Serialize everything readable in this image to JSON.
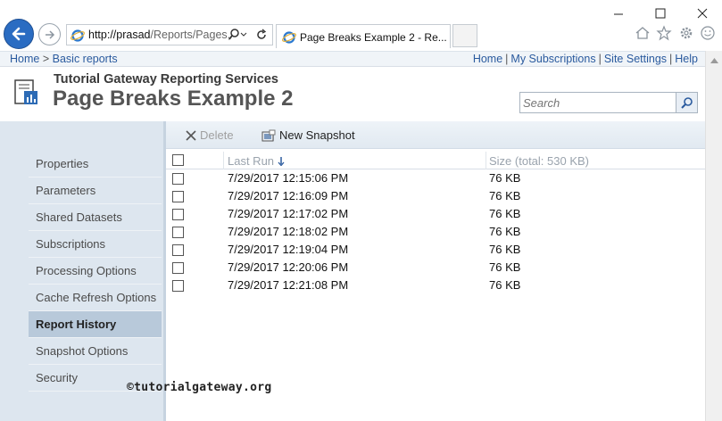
{
  "browser": {
    "url_host": "http://prasad",
    "url_path": "/Reports/Pages,",
    "tab_title": "Page Breaks Example 2 - Re...",
    "icons": [
      "back-arrow-icon",
      "forward-arrow-icon",
      "ie-logo-icon",
      "search-icon",
      "refresh-icon",
      "minimize-icon",
      "maximize-icon",
      "close-icon",
      "home-icon",
      "star-icon",
      "gear-icon",
      "smiley-icon"
    ]
  },
  "nav": {
    "breadcrumb_home": "Home",
    "breadcrumb_sep": ">",
    "breadcrumb_current": "Basic reports",
    "links": [
      "Home",
      "My Subscriptions",
      "Site Settings",
      "Help"
    ],
    "link_sep": "|"
  },
  "header": {
    "site_name": "Tutorial Gateway Reporting Services",
    "page_title": "Page Breaks Example 2"
  },
  "search": {
    "placeholder": "Search"
  },
  "sidebar": {
    "items": [
      {
        "label": "Properties",
        "active": false
      },
      {
        "label": "Parameters",
        "active": false
      },
      {
        "label": "Shared Datasets",
        "active": false
      },
      {
        "label": "Subscriptions",
        "active": false
      },
      {
        "label": "Processing Options",
        "active": false
      },
      {
        "label": "Cache Refresh Options",
        "active": false
      },
      {
        "label": "Report History",
        "active": true
      },
      {
        "label": "Snapshot Options",
        "active": false
      },
      {
        "label": "Security",
        "active": false
      }
    ]
  },
  "toolbar": {
    "delete_label": "Delete",
    "new_snapshot_label": "New Snapshot"
  },
  "grid": {
    "col_last_run": "Last Run",
    "col_size": "Size (total: 530 KB)",
    "rows": [
      {
        "last_run": "7/29/2017 12:15:06 PM",
        "size": "76 KB"
      },
      {
        "last_run": "7/29/2017 12:16:09 PM",
        "size": "76 KB"
      },
      {
        "last_run": "7/29/2017 12:17:02 PM",
        "size": "76 KB"
      },
      {
        "last_run": "7/29/2017 12:18:02 PM",
        "size": "76 KB"
      },
      {
        "last_run": "7/29/2017 12:19:04 PM",
        "size": "76 KB"
      },
      {
        "last_run": "7/29/2017 12:20:06 PM",
        "size": "76 KB"
      },
      {
        "last_run": "7/29/2017 12:21:08 PM",
        "size": "76 KB"
      }
    ]
  },
  "watermark": "©tutorialgateway.org",
  "colors": {
    "link": "#2a5a9e",
    "sidebar_bg": "#dde6ef",
    "sidebar_active": "#b8c9da",
    "back_button": "#2a6cc2"
  }
}
